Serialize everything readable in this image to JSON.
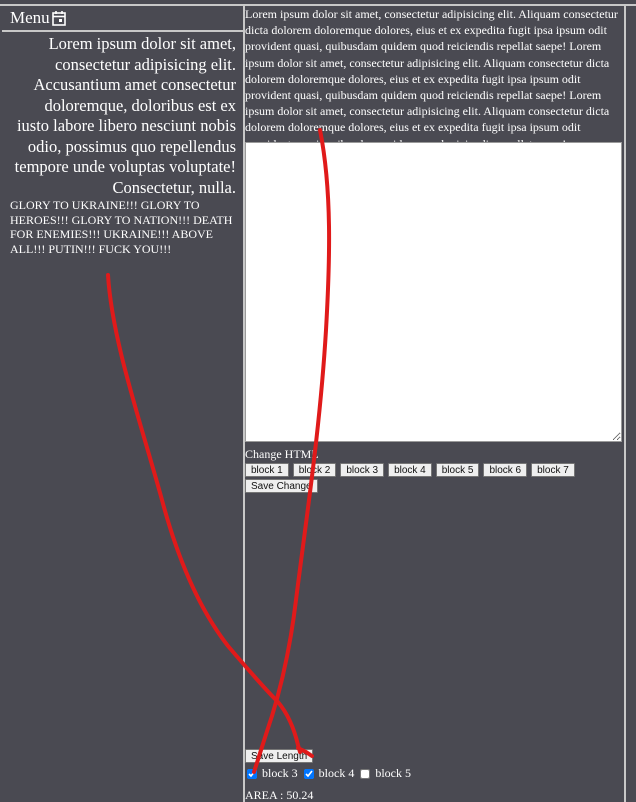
{
  "sidebar": {
    "menu_label": "Menu",
    "menu_icon": "calendar-icon",
    "text": "Lorem ipsum dolor sit amet, consectetur adipisicing elit. Accusantium amet consectetur doloremque, doloribus est ex iusto labore libero nesciunt nobis odio, possimus quo repellendus tempore unde voluptas voluptate! Consectetur, nulla.",
    "glory_text": "GLORY TO UKRAINE!!! GLORY TO HEROES!!! GLORY TO NATION!!! DEATH FOR ENEMIES!!! UKRAINE!!! ABOVE ALL!!! PUTIN!!! FUCK YOU!!!"
  },
  "main": {
    "lorem": "Lorem ipsum dolor sit amet, consectetur adipisicing elit. Aliquam consectetur dicta dolorem doloremque dolores, eius et ex expedita fugit ipsa ipsum odit provident quasi, quibusdam quidem quod reiciendis repellat saepe! Lorem ipsum dolor sit amet, consectetur adipisicing elit. Aliquam consectetur dicta dolorem doloremque dolores, eius et ex expedita fugit ipsa ipsum odit provident quasi, quibusdam quidem quod reiciendis repellat saepe! Lorem ipsum dolor sit amet, consectetur adipisicing elit. Aliquam consectetur dicta dolorem doloremque dolores, eius et ex expedita fugit ipsa ipsum odit provident quasi, quibusdam quidem quod reiciendis repellat saepe!",
    "editor_value": "",
    "change_html_label": "Change HTML",
    "block_buttons": [
      "block 1",
      "block 2",
      "block 3",
      "block 4",
      "block 5",
      "block 6",
      "block 7"
    ],
    "save_change_label": "Save Change",
    "save_length_label": "Save Length",
    "checkboxes": [
      {
        "label": "block 3",
        "checked": true
      },
      {
        "label": "block 4",
        "checked": true
      },
      {
        "label": "block 5",
        "checked": false
      }
    ],
    "area_text": "AREA : 50.24"
  },
  "colors": {
    "background": "#4a4a52",
    "border": "#c8c8c8",
    "annotation": "#e01a1a"
  }
}
